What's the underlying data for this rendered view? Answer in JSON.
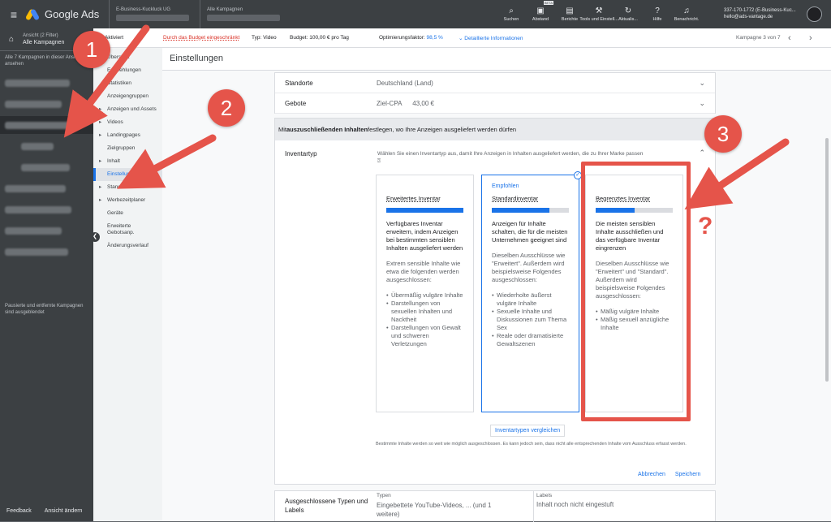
{
  "topbar": {
    "app_name": "Google Ads",
    "account_crumb": "E-Business-Kuckluck UG",
    "campaign_crumb": "Alle Kampagnen",
    "tools": [
      {
        "icon": "search-icon",
        "glyph": "⌕",
        "label": "Suchen"
      },
      {
        "icon": "appearance-icon",
        "glyph": "▣",
        "label": "Abstand",
        "badge": "BETA"
      },
      {
        "icon": "reports-icon",
        "glyph": "▤",
        "label": "Berichte"
      },
      {
        "icon": "wrench-icon",
        "glyph": "⚒",
        "label": "Tools und Einstell..."
      },
      {
        "icon": "refresh-icon",
        "glyph": "↻",
        "label": "Aktualis..."
      },
      {
        "icon": "help-icon",
        "glyph": "?",
        "label": "Hilfe"
      },
      {
        "icon": "bell-icon",
        "glyph": "♫",
        "label": "Benachricht."
      }
    ],
    "account_id": "337-170-1772 (E-Business-Kuc...",
    "account_email": "hello@ads-vantage.de"
  },
  "leftnav": {
    "view_label": "Ansicht (2 Filter)",
    "view_value": "Alle Kampagnen",
    "note": "Alle 7 Kampagnen in dieser Ansicht ansehen",
    "footer": "Pausierte und entfernte Kampagnen sind ausgeblendet",
    "feedback": "Feedback",
    "change_view": "Ansicht ändern"
  },
  "subnav": {
    "items": [
      {
        "label": "Übersicht",
        "arrow": false
      },
      {
        "label": "Empfehlungen",
        "arrow": false
      },
      {
        "label": "Statistiken",
        "arrow": false
      },
      {
        "label": "Anzeigengruppen",
        "arrow": false
      },
      {
        "label": "Anzeigen und Assets",
        "arrow": true
      },
      {
        "label": "Videos",
        "arrow": true
      },
      {
        "label": "Landingpages",
        "arrow": true
      },
      {
        "label": "Zielgruppen",
        "arrow": false
      },
      {
        "label": "Inhalt",
        "arrow": true
      },
      {
        "label": "Einstellungen",
        "arrow": false,
        "selected": true
      },
      {
        "label": "Standorte",
        "arrow": true
      },
      {
        "label": "Werbezeitplaner",
        "arrow": true
      },
      {
        "label": "Geräte",
        "arrow": false
      },
      {
        "label": "Erweiterte Gebotsanp.",
        "arrow": false
      },
      {
        "label": "Änderungsverlauf",
        "arrow": false
      }
    ]
  },
  "statusbar": {
    "status": "Aktiviert",
    "budget_warning": "Durch das Budget eingeschränkt",
    "type": "Typ: Video",
    "budget": "Budget: 100,00 € pro Tag",
    "opt_label": "Optimierungsfaktor:",
    "opt_value": "98,5 %",
    "details": "Detaillierte Informationen",
    "pager": "Kampagne 3 von 7"
  },
  "page_title": "Einstellungen",
  "settings": {
    "rows": [
      {
        "key": "Standorte",
        "value": "Deutschland (Land)"
      },
      {
        "key": "Gebote",
        "value": "Ziel-CPA      43,00 €"
      }
    ],
    "section_prefix": "Mit ",
    "section_bold": "auszuschließenden Inhalten",
    "section_suffix": " festlegen, wo Ihre Anzeigen ausgeliefert werden dürfen",
    "inventory_label": "Inventartyp",
    "inventory_desc": "Wählen Sie einen Inventartyp aus, damit Ihre Anzeigen in Inhalten ausgeliefert werden, die zu Ihrer Marke passen"
  },
  "options": [
    {
      "recommended": "",
      "name": "Erweitertes Inventar",
      "fill": 1.0,
      "main": "Verfügbares Inventar erweitern, indem Anzeigen bei bestimmten sensiblen Inhalten ausgeliefert werden",
      "sub": "Extrem sensible Inhalte wie etwa die folgenden werden ausgeschlossen:",
      "list": [
        "Übermäßig vulgäre Inhalte",
        "Darstellungen von sexuellen Inhalten und Nacktheit",
        "Darstellungen von Gewalt und schweren Verletzungen"
      ]
    },
    {
      "recommended": "Empfohlen",
      "name": "Standardinventar",
      "fill": 0.75,
      "main": "Anzeigen für Inhalte schalten, die für die meisten Unternehmen geeignet sind",
      "sub": "Dieselben Ausschlüsse wie \"Erweitert\". Außerdem wird beispielsweise Folgendes ausgeschlossen:",
      "list": [
        "Wiederholte äußerst vulgäre Inhalte",
        "Sexuelle Inhalte und Diskussionen zum Thema Sex",
        "Reale oder dramatisierte Gewaltszenen"
      ]
    },
    {
      "recommended": "",
      "name": "Begrenztes Inventar",
      "fill": 0.5,
      "main": "Die meisten sensiblen Inhalte ausschließen und das verfügbare Inventar eingrenzen",
      "sub": "Dieselben Ausschlüsse wie \"Erweitert\" und \"Standard\". Außerdem wird beispielsweise Folgendes ausgeschlossen:",
      "list": [
        "Mäßig vulgäre Inhalte",
        "Mäßig sexuell anzügliche Inhalte"
      ]
    }
  ],
  "compare_button": "Inventartypen vergleichen",
  "footnote": "Bestimmte Inhalte werden so weit wie möglich ausgeschlossen. Es kann jedoch sein, dass nicht alle entsprechenden Inhalte vom Ausschluss erfasst werden.",
  "actions": {
    "cancel": "Abbrechen",
    "save": "Speichern"
  },
  "excluded": {
    "label": "Ausgeschlossene Typen und Labels",
    "types_head": "Typen",
    "types_value": "Eingebettete YouTube-Videos, ... (und 1 weitere)",
    "labels_head": "Labels",
    "labels_value": "Inhalt noch nicht eingestuft"
  },
  "annotations": {
    "n1": "1",
    "n2": "2",
    "n3": "3",
    "q": "?",
    "color": "#e5544a"
  }
}
